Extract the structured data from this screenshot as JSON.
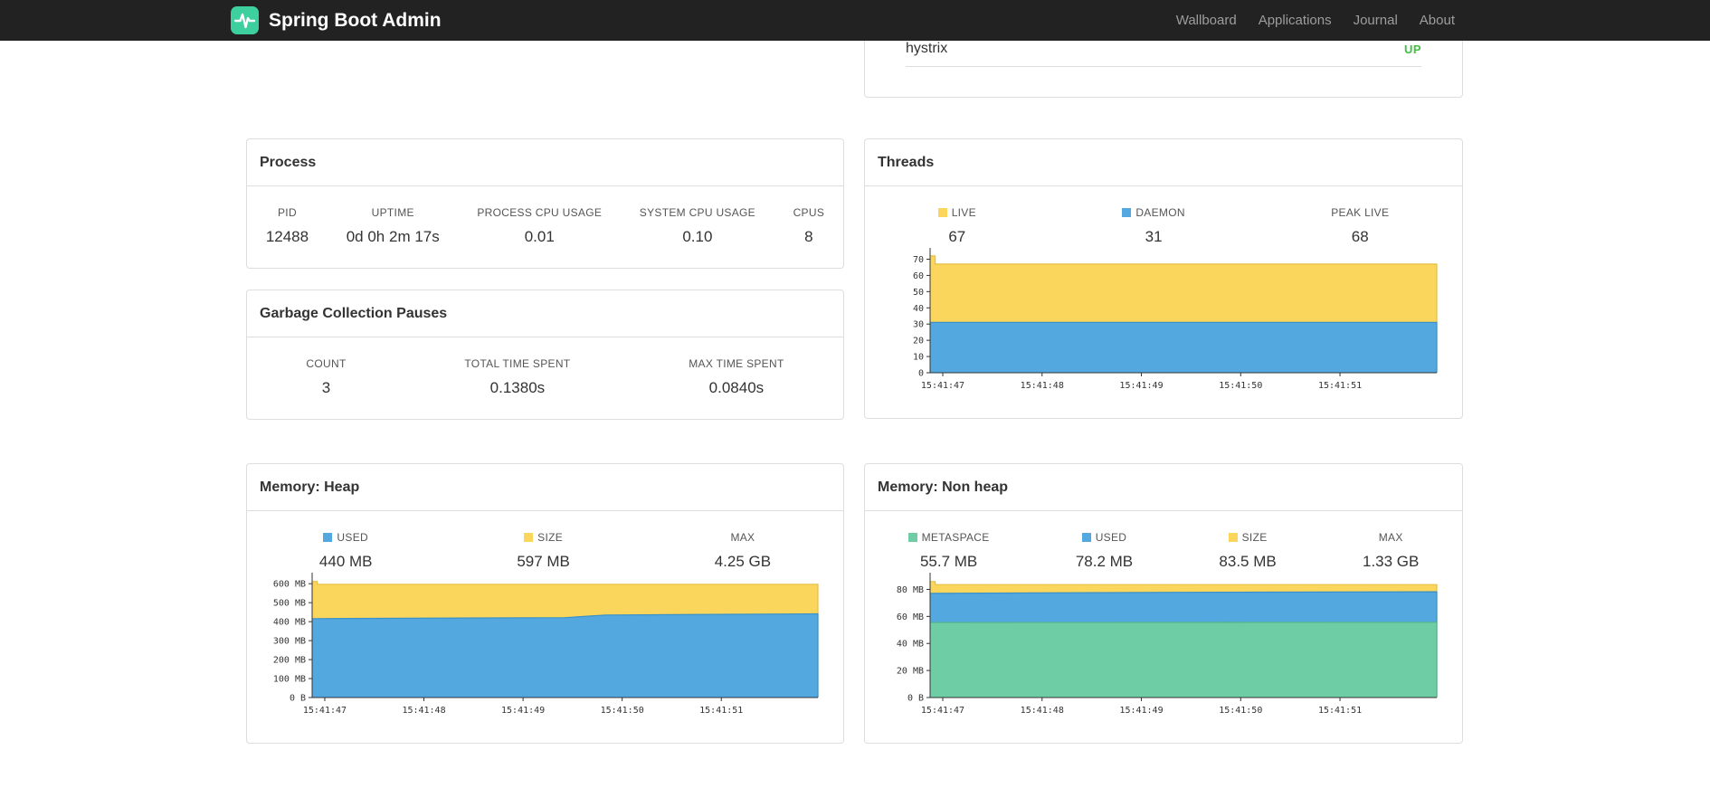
{
  "colors": {
    "navbar_bg": "#222222",
    "nav_link": "#9d9d9d",
    "brand_green": "#3ECF9E",
    "status_up": "#44BE44",
    "panel_border": "#dddddd",
    "series_yellow": "#FBD65D",
    "series_blue": "#53A8DF",
    "series_green": "#6ECDA5"
  },
  "navbar": {
    "brand": "Spring Boot Admin",
    "links": [
      {
        "label": "Wallboard"
      },
      {
        "label": "Applications"
      },
      {
        "label": "Journal"
      },
      {
        "label": "About"
      }
    ]
  },
  "status_panel": {
    "rows": [
      {
        "name": "hystrix",
        "status": "UP"
      }
    ]
  },
  "panels": {
    "process": {
      "title": "Process",
      "metrics": [
        {
          "label": "PID",
          "value": "12488"
        },
        {
          "label": "UPTIME",
          "value": "0d 0h 2m 17s"
        },
        {
          "label": "PROCESS CPU USAGE",
          "value": "0.01"
        },
        {
          "label": "SYSTEM CPU USAGE",
          "value": "0.10"
        },
        {
          "label": "CPUS",
          "value": "8"
        }
      ]
    },
    "gc": {
      "title": "Garbage Collection Pauses",
      "metrics": [
        {
          "label": "COUNT",
          "value": "3"
        },
        {
          "label": "TOTAL TIME SPENT",
          "value": "0.1380s"
        },
        {
          "label": "MAX TIME SPENT",
          "value": "0.0840s"
        }
      ]
    },
    "threads": {
      "title": "Threads",
      "legend": [
        {
          "label": "LIVE",
          "value": "67",
          "color": "#FBD65D"
        },
        {
          "label": "DAEMON",
          "value": "31",
          "color": "#53A8DF"
        },
        {
          "label": "PEAK LIVE",
          "value": "68"
        }
      ]
    },
    "heap": {
      "title": "Memory: Heap",
      "legend": [
        {
          "label": "USED",
          "value": "440 MB",
          "color": "#53A8DF"
        },
        {
          "label": "SIZE",
          "value": "597 MB",
          "color": "#FBD65D"
        },
        {
          "label": "MAX",
          "value": "4.25 GB"
        }
      ]
    },
    "nonheap": {
      "title": "Memory: Non heap",
      "legend": [
        {
          "label": "METASPACE",
          "value": "55.7 MB",
          "color": "#6ECDA5"
        },
        {
          "label": "USED",
          "value": "78.2 MB",
          "color": "#53A8DF"
        },
        {
          "label": "SIZE",
          "value": "83.5 MB",
          "color": "#FBD65D"
        },
        {
          "label": "MAX",
          "value": "1.33 GB"
        }
      ]
    }
  },
  "chart_data": [
    {
      "id": "threads-chart",
      "type": "area",
      "title": "Threads",
      "x_axis": {
        "fractions": [
          0.025,
          0.221,
          0.417,
          0.613,
          0.809
        ],
        "labels": [
          "15:41:47",
          "15:41:48",
          "15:41:49",
          "15:41:50",
          "15:41:51"
        ]
      },
      "y_axis": {
        "max": 72.5,
        "ticks": [
          0,
          10,
          20,
          30,
          40,
          50,
          60,
          70
        ],
        "labels": [
          "0",
          "10",
          "20",
          "30",
          "40",
          "50",
          "60",
          "70"
        ]
      },
      "series": [
        {
          "name": "live",
          "color": "#FBD65D",
          "stroke": "#E6BE45",
          "points": [
            [
              0,
              72
            ],
            [
              0.01,
              72
            ],
            [
              0.01,
              67
            ],
            [
              1,
              67
            ]
          ]
        },
        {
          "name": "daemon",
          "color": "#53A8DF",
          "stroke": "#3A90C8",
          "points": [
            [
              0,
              31
            ],
            [
              1,
              31
            ]
          ]
        }
      ]
    },
    {
      "id": "heap-chart",
      "type": "area",
      "title": "Memory: Heap",
      "x_axis": {
        "fractions": [
          0.025,
          0.221,
          0.417,
          0.613,
          0.809
        ],
        "labels": [
          "15:41:47",
          "15:41:48",
          "15:41:49",
          "15:41:50",
          "15:41:51"
        ]
      },
      "y_axis": {
        "max": 620,
        "ticks": [
          0,
          100,
          200,
          300,
          400,
          500,
          600
        ],
        "labels": [
          "0 B",
          "100 MB",
          "200 MB",
          "300 MB",
          "400 MB",
          "500 MB",
          "600 MB"
        ]
      },
      "series": [
        {
          "name": "size",
          "color": "#FBD65D",
          "stroke": "#E6BE45",
          "points": [
            [
              0,
              612
            ],
            [
              0.01,
              612
            ],
            [
              0.01,
              597
            ],
            [
              1,
              597
            ]
          ]
        },
        {
          "name": "used",
          "color": "#53A8DF",
          "stroke": "#3A90C8",
          "points": [
            [
              0,
              416
            ],
            [
              0.5,
              421
            ],
            [
              0.58,
              435
            ],
            [
              1,
              441
            ]
          ]
        }
      ]
    },
    {
      "id": "nonheap-chart",
      "type": "area",
      "title": "Memory: Non heap",
      "x_axis": {
        "fractions": [
          0.025,
          0.221,
          0.417,
          0.613,
          0.809
        ],
        "labels": [
          "15:41:47",
          "15:41:48",
          "15:41:49",
          "15:41:50",
          "15:41:51"
        ]
      },
      "y_axis": {
        "max": 87,
        "ticks": [
          0,
          20,
          40,
          60,
          80
        ],
        "labels": [
          "0 B",
          "20 MB",
          "40 MB",
          "60 MB",
          "80 MB"
        ]
      },
      "series": [
        {
          "name": "size",
          "color": "#FBD65D",
          "stroke": "#E6BE45",
          "points": [
            [
              0,
              85.8
            ],
            [
              0.01,
              85.8
            ],
            [
              0.01,
              83.5
            ],
            [
              1,
              83.5
            ]
          ]
        },
        {
          "name": "used",
          "color": "#53A8DF",
          "stroke": "#3A90C8",
          "points": [
            [
              0,
              77
            ],
            [
              0.5,
              77.8
            ],
            [
              1,
              78.2
            ]
          ]
        },
        {
          "name": "metaspace",
          "color": "#6ECDA5",
          "stroke": "#52B78A",
          "points": [
            [
              0,
              55.5
            ],
            [
              1,
              55.7
            ]
          ]
        }
      ]
    }
  ]
}
